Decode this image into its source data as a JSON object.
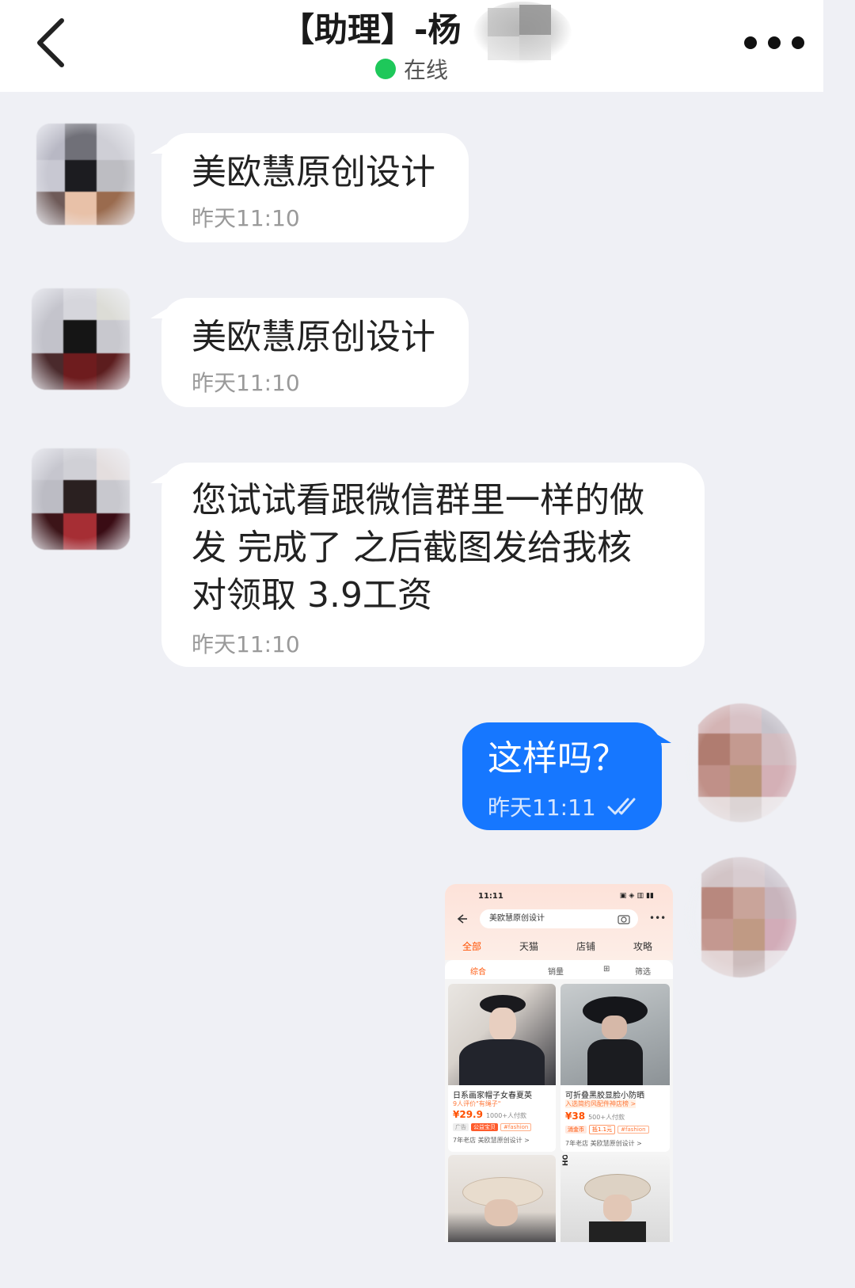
{
  "header": {
    "title": "【助理】-杨",
    "status": "在线"
  },
  "messages": [
    {
      "text": "美欧慧原创设计",
      "time": "昨天11:10"
    },
    {
      "text": "美欧慧原创设计",
      "time": "昨天11:10"
    },
    {
      "lines": [
        "您试试看跟微信群里一样的做",
        "发 完成了 之后截图发给我核",
        "对领取 3.9工资"
      ],
      "time": "昨天11:10"
    }
  ],
  "my_message": {
    "text": "这样吗？",
    "time": "昨天11:11"
  },
  "screenshot": {
    "status_time": "11:11",
    "search_text": "美欧慧原创设计",
    "tabs": [
      "全部",
      "天猫",
      "店铺",
      "攻略"
    ],
    "filters": [
      "综合",
      "销量",
      "筛选"
    ],
    "products": [
      {
        "title": "日系画家帽子女春夏英",
        "note": "9人评价\"有绳子\"",
        "price": "¥29.9",
        "sold": "1000+人付款",
        "tags": [
          "广告",
          "公益宝贝",
          "#fashion"
        ],
        "shop": "7年老店 美欧慧原创设计 >"
      },
      {
        "title": "可折叠黑胶显脸小防晒",
        "note": "入选简约风配件神店榜 >",
        "price": "¥38",
        "sold": "500+人付款",
        "tags": [
          "消金币",
          "抵1.1元",
          "#fashion"
        ],
        "shop": "7年老店 美欧慧原创设计 >"
      }
    ],
    "side_text": "HOW"
  }
}
